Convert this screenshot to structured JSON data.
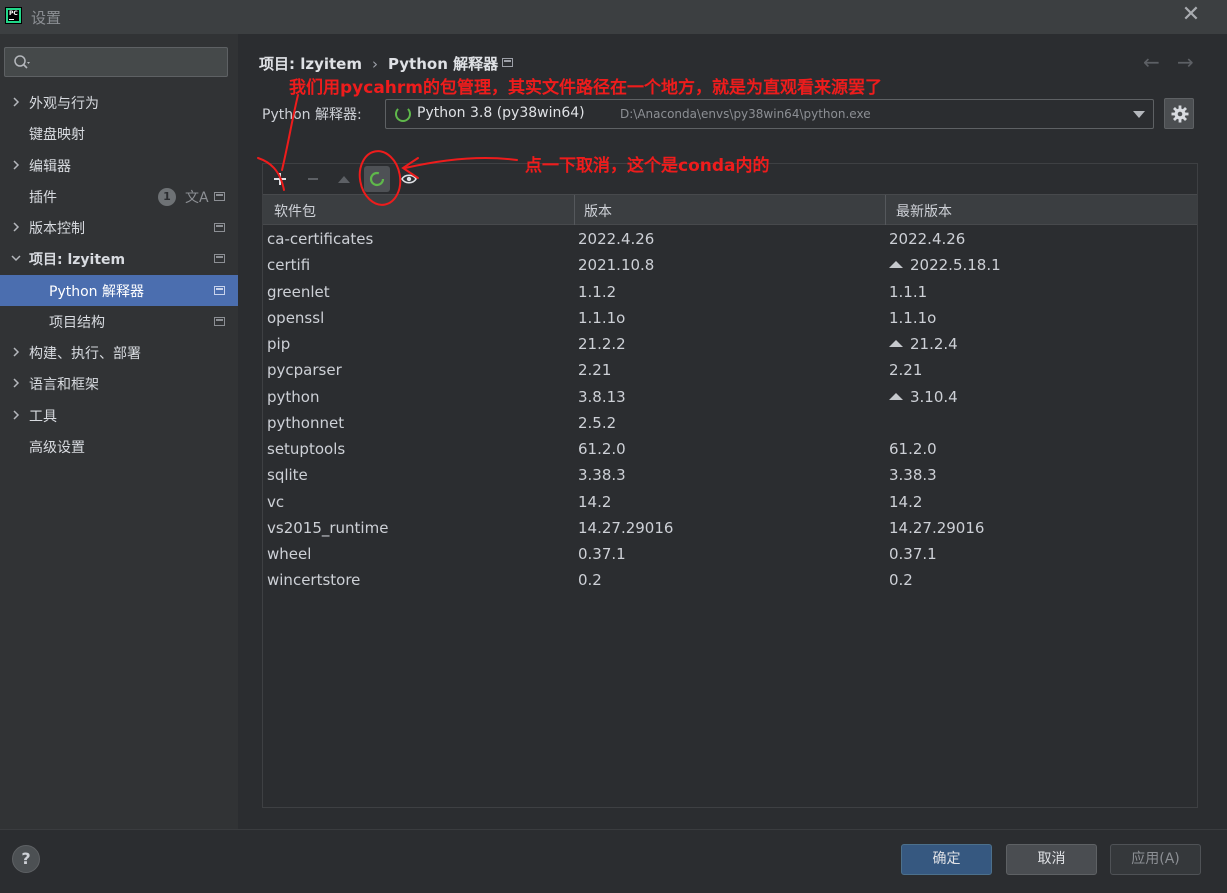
{
  "window": {
    "title": "设置",
    "close_glyph": "✕"
  },
  "search": {
    "placeholder": ""
  },
  "sidebar": {
    "items": [
      {
        "label": "外观与行为",
        "expandable": true
      },
      {
        "label": "键盘映射",
        "expandable": false
      },
      {
        "label": "编辑器",
        "expandable": true
      },
      {
        "label": "插件",
        "expandable": false,
        "badge": "1",
        "translate_icon": "文A"
      },
      {
        "label": "版本控制",
        "expandable": true
      },
      {
        "label": "项目: lzyitem",
        "expandable": true,
        "expanded": true
      },
      {
        "label": "Python 解释器",
        "child": true,
        "selected": true
      },
      {
        "label": "项目结构",
        "child": true
      },
      {
        "label": "构建、执行、部署",
        "expandable": true
      },
      {
        "label": "语言和框架",
        "expandable": true
      },
      {
        "label": "工具",
        "expandable": true
      },
      {
        "label": "高级设置",
        "expandable": false
      }
    ]
  },
  "breadcrumb": {
    "project": "项目: lzyitem",
    "separator": "›",
    "page": "Python 解释器"
  },
  "nav": {
    "back": "←",
    "forward": "→"
  },
  "interpreter": {
    "label": "Python 解释器:",
    "name": "Python 3.8 (py38win64)",
    "path": "D:\\Anaconda\\envs\\py38win64\\python.exe"
  },
  "packages": {
    "columns": [
      "软件包",
      "版本",
      "最新版本"
    ],
    "rows": [
      {
        "name": "ca-certificates",
        "version": "2022.4.26",
        "latest": "2022.4.26",
        "upgrade": false
      },
      {
        "name": "certifi",
        "version": "2021.10.8",
        "latest": "2022.5.18.1",
        "upgrade": true
      },
      {
        "name": "greenlet",
        "version": "1.1.2",
        "latest": "1.1.1",
        "upgrade": false
      },
      {
        "name": "openssl",
        "version": "1.1.1o",
        "latest": "1.1.1o",
        "upgrade": false
      },
      {
        "name": "pip",
        "version": "21.2.2",
        "latest": "21.2.4",
        "upgrade": true
      },
      {
        "name": "pycparser",
        "version": "2.21",
        "latest": "2.21",
        "upgrade": false
      },
      {
        "name": "python",
        "version": "3.8.13",
        "latest": "3.10.4",
        "upgrade": true
      },
      {
        "name": "pythonnet",
        "version": "2.5.2",
        "latest": "",
        "upgrade": false
      },
      {
        "name": "setuptools",
        "version": "61.2.0",
        "latest": "61.2.0",
        "upgrade": false
      },
      {
        "name": "sqlite",
        "version": "3.38.3",
        "latest": "3.38.3",
        "upgrade": false
      },
      {
        "name": "vc",
        "version": "14.2",
        "latest": "14.2",
        "upgrade": false
      },
      {
        "name": "vs2015_runtime",
        "version": "14.27.29016",
        "latest": "14.27.29016",
        "upgrade": false
      },
      {
        "name": "wheel",
        "version": "0.37.1",
        "latest": "0.37.1",
        "upgrade": false
      },
      {
        "name": "wincertstore",
        "version": "0.2",
        "latest": "0.2",
        "upgrade": false
      }
    ]
  },
  "annotations": {
    "top": "我们用pycahrm的包管理，其实文件路径在一个地方，就是为直观看来源罢了",
    "toolbar": "点一下取消，这个是conda内的",
    "color": "#ee1c1c"
  },
  "footer": {
    "help": "?",
    "ok": "确定",
    "cancel": "取消",
    "apply": "应用(A)"
  },
  "colors": {
    "accent": "#4b6eaf",
    "ok_button": "#365880",
    "conda_ring": "#5fb84b"
  }
}
